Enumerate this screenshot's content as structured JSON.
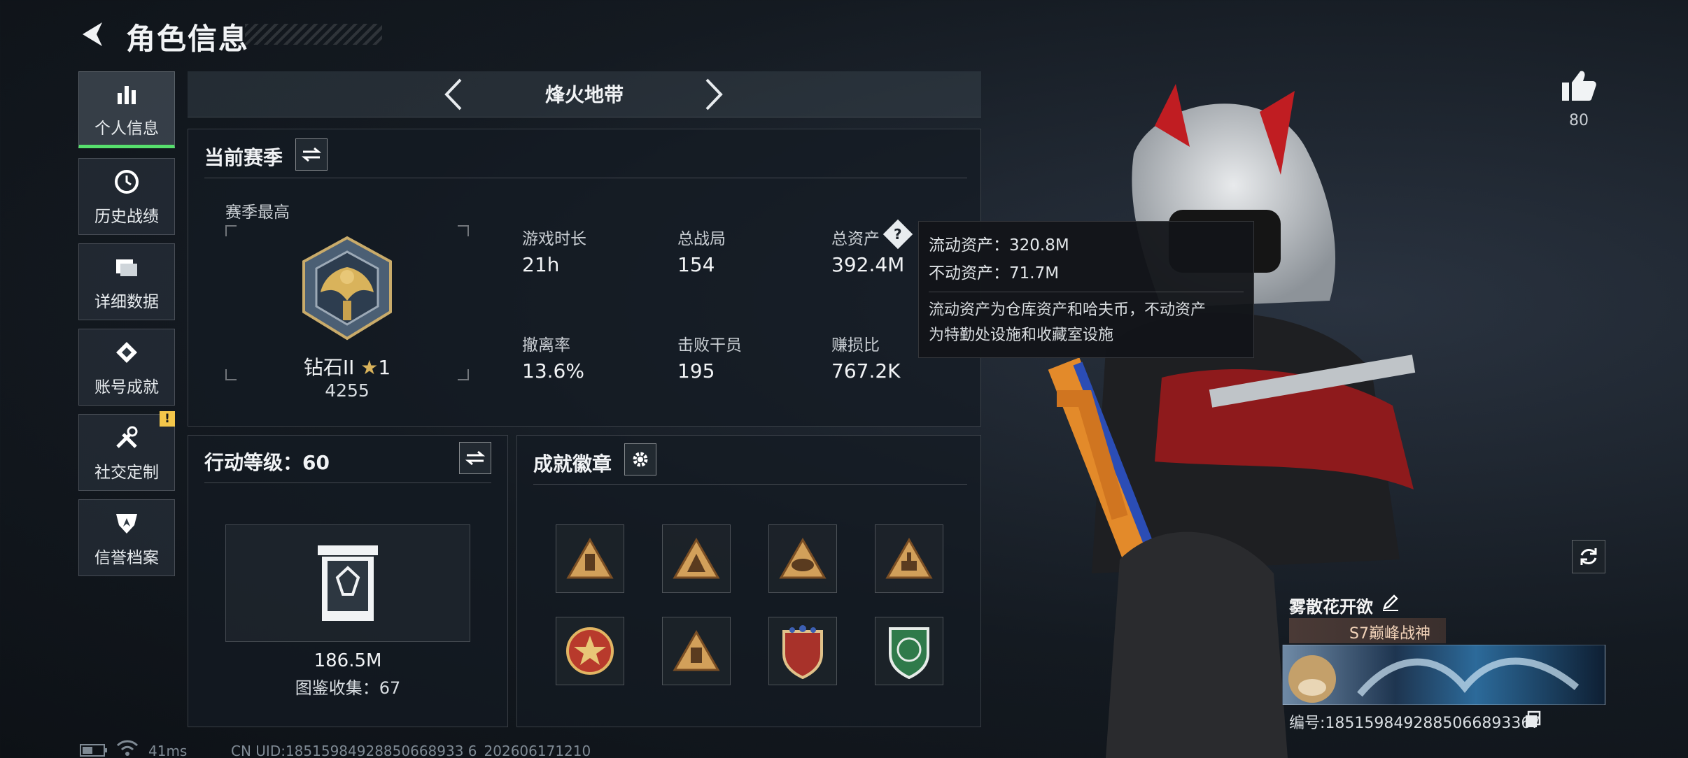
{
  "header": {
    "title": "角色信息"
  },
  "sidebar": {
    "items": [
      {
        "label": "个人信息",
        "icon": "bar-chart-icon",
        "active": true
      },
      {
        "label": "历史战绩",
        "icon": "history-icon"
      },
      {
        "label": "详细数据",
        "icon": "folder-icon"
      },
      {
        "label": "账号成就",
        "icon": "achievement-icon"
      },
      {
        "label": "社交定制",
        "icon": "tools-icon",
        "badge": "!"
      },
      {
        "label": "信誉档案",
        "icon": "shield-icon"
      }
    ]
  },
  "mode": {
    "title": "烽火地带"
  },
  "season": {
    "title": "当前赛季",
    "best_label": "赛季最高",
    "rank_name": "钻石II",
    "rank_star_count": "1",
    "rank_score": "4255",
    "stats": [
      {
        "label": "游戏时长",
        "value": "21h"
      },
      {
        "label": "总战局",
        "value": "154"
      },
      {
        "label": "总资产",
        "value": "392.4M"
      },
      {
        "label": "撤离率",
        "value": "13.6%"
      },
      {
        "label": "击败干员",
        "value": "195"
      },
      {
        "label": "赚损比",
        "value": "767.2K"
      }
    ]
  },
  "tooltip": {
    "liquid": "流动资产：320.8M",
    "fixed": "不动资产：71.7M",
    "desc_line1": "流动资产为仓库资产和哈夫币，不动资产",
    "desc_line2": "为特勤处设施和收藏室设施"
  },
  "action": {
    "title": "行动等级：60",
    "value": "186.5M",
    "collection": "图鉴收集：67"
  },
  "achievements": {
    "title": "成就徽章"
  },
  "character": {
    "likes": "80",
    "player_name": "雾散花开欲",
    "rank_tag": "S7巅峰战神",
    "player_id": "编号:1851598492885066893367"
  },
  "status": {
    "ping": "41ms",
    "uid": "CN UID:18515984928850668933 6_202606171210"
  },
  "colors": {
    "accent": "#57e06d",
    "warning": "#f3c64a"
  }
}
